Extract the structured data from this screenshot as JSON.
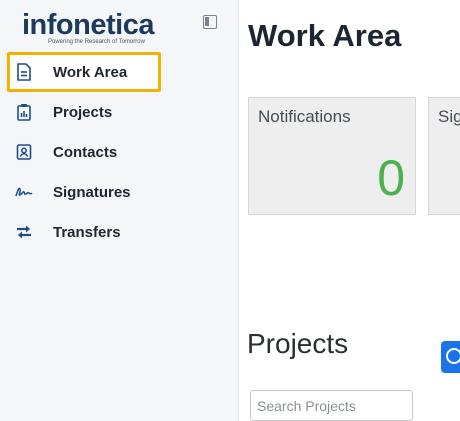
{
  "brand": {
    "name": "infonetica",
    "tagline": "Powering the Research of Tomorrow"
  },
  "sidebar": {
    "items": [
      {
        "label": "Work Area",
        "icon": "document-icon",
        "active": true
      },
      {
        "label": "Projects",
        "icon": "clipboard-chart-icon",
        "active": false
      },
      {
        "label": "Contacts",
        "icon": "contact-card-icon",
        "active": false
      },
      {
        "label": "Signatures",
        "icon": "signature-icon",
        "active": false
      },
      {
        "label": "Transfers",
        "icon": "transfer-arrows-icon",
        "active": false
      }
    ]
  },
  "main": {
    "title": "Work Area",
    "cards": [
      {
        "title": "Notifications",
        "count": "0"
      },
      {
        "title": "Sig",
        "count": ""
      }
    ],
    "projects": {
      "title": "Projects",
      "search_placeholder": "Search Projects"
    }
  },
  "colors": {
    "accent_highlight": "#f0b400",
    "brand": "#1b3a5c",
    "icon": "#1e4f8a",
    "count_green": "#4caf50",
    "add_button": "#1a73e8"
  }
}
